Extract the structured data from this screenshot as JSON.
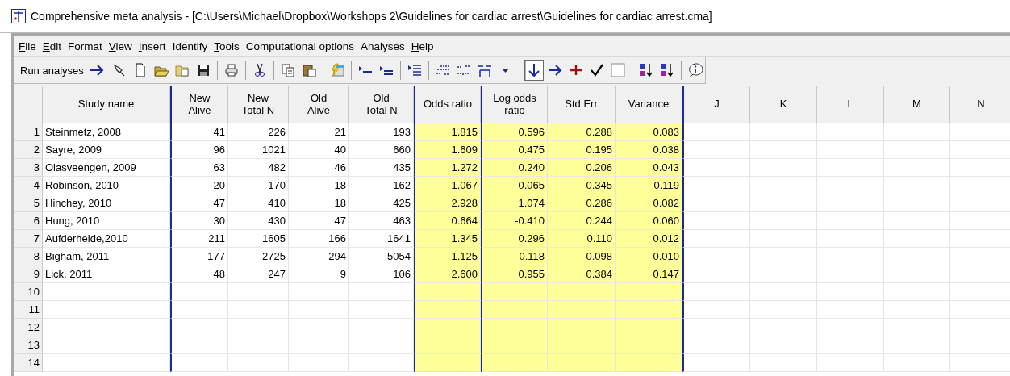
{
  "window": {
    "title": "Comprehensive meta analysis - [C:\\Users\\Michael\\Dropbox\\Workshops 2\\Guidelines for cardiac arrest\\Guidelines for cardiac arrest.cma]"
  },
  "menu": [
    {
      "label": "File",
      "mnemonic": true
    },
    {
      "label": "Edit",
      "mnemonic": true
    },
    {
      "label": "Format",
      "mnemonic": false
    },
    {
      "label": "View",
      "mnemonic": true
    },
    {
      "label": "Insert",
      "mnemonic": true
    },
    {
      "label": "Identify",
      "mnemonic": false
    },
    {
      "label": "Tools",
      "mnemonic": true
    },
    {
      "label": "Computational options",
      "mnemonic": false
    },
    {
      "label": "Analyses",
      "mnemonic": false
    },
    {
      "label": "Help",
      "mnemonic": true
    }
  ],
  "toolbar": {
    "run_label": "Run analyses",
    "items": [
      {
        "kind": "pin",
        "selected": false
      },
      {
        "kind": "page",
        "selected": false
      },
      {
        "kind": "open",
        "selected": false
      },
      {
        "kind": "folder-grid",
        "selected": false
      },
      {
        "kind": "save",
        "selected": false
      },
      {
        "kind": "separator"
      },
      {
        "kind": "print",
        "selected": false
      },
      {
        "kind": "separator"
      },
      {
        "kind": "scissors",
        "selected": false
      },
      {
        "kind": "separator"
      },
      {
        "kind": "copy",
        "selected": false
      },
      {
        "kind": "paste",
        "selected": false
      },
      {
        "kind": "separator"
      },
      {
        "kind": "lightning",
        "selected": false
      },
      {
        "kind": "separator"
      },
      {
        "kind": "indent-line",
        "selected": false
      },
      {
        "kind": "indent-equal",
        "selected": false
      },
      {
        "kind": "separator"
      },
      {
        "kind": "indent-list",
        "selected": false
      },
      {
        "kind": "separator"
      },
      {
        "kind": "decimal-add",
        "selected": false
      },
      {
        "kind": "decimal-remove",
        "selected": false
      },
      {
        "kind": "column-width",
        "selected": false
      },
      {
        "kind": "caret",
        "selected": false
      },
      {
        "kind": "separator"
      },
      {
        "kind": "arrow-down",
        "selected": true
      },
      {
        "kind": "arrow-right",
        "selected": false
      },
      {
        "kind": "plus",
        "selected": false
      },
      {
        "kind": "check",
        "selected": false
      },
      {
        "kind": "blank",
        "selected": false
      },
      {
        "kind": "separator"
      },
      {
        "kind": "sort-asc",
        "selected": false
      },
      {
        "kind": "sort-desc",
        "selected": false
      },
      {
        "kind": "separator"
      },
      {
        "kind": "info",
        "selected": false
      }
    ]
  },
  "table": {
    "columns": [
      {
        "label": "Study name",
        "kind": "text",
        "divider": false
      },
      {
        "label": "New\nAlive",
        "kind": "input",
        "divider": true
      },
      {
        "label": "New\nTotal N",
        "kind": "input",
        "divider": false
      },
      {
        "label": "Old\nAlive",
        "kind": "input",
        "divider": false
      },
      {
        "label": "Old\nTotal N",
        "kind": "input",
        "divider": false
      },
      {
        "label": "Odds ratio",
        "kind": "computed",
        "divider": true
      },
      {
        "label": "Log odds\nratio",
        "kind": "computed",
        "divider": true
      },
      {
        "label": "Std Err",
        "kind": "computed",
        "divider": false
      },
      {
        "label": "Variance",
        "kind": "computed",
        "divider": false
      },
      {
        "label": "J",
        "kind": "empty",
        "divider": true
      },
      {
        "label": "K",
        "kind": "empty",
        "divider": false
      },
      {
        "label": "L",
        "kind": "empty",
        "divider": false
      },
      {
        "label": "M",
        "kind": "empty",
        "divider": false
      },
      {
        "label": "N",
        "kind": "empty",
        "divider": false
      }
    ],
    "rows": [
      {
        "number": "1",
        "cells": [
          "Steinmetz, 2008",
          "41",
          "226",
          "21",
          "193",
          "1.815",
          "0.596",
          "0.288",
          "0.083"
        ]
      },
      {
        "number": "2",
        "cells": [
          "Sayre, 2009",
          "96",
          "1021",
          "40",
          "660",
          "1.609",
          "0.475",
          "0.195",
          "0.038"
        ]
      },
      {
        "number": "3",
        "cells": [
          "Olasveengen, 2009",
          "63",
          "482",
          "46",
          "435",
          "1.272",
          "0.240",
          "0.206",
          "0.043"
        ]
      },
      {
        "number": "4",
        "cells": [
          "Robinson, 2010",
          "20",
          "170",
          "18",
          "162",
          "1.067",
          "0.065",
          "0.345",
          "0.119"
        ]
      },
      {
        "number": "5",
        "cells": [
          "Hinchey, 2010",
          "47",
          "410",
          "18",
          "425",
          "2.928",
          "1.074",
          "0.286",
          "0.082"
        ]
      },
      {
        "number": "6",
        "cells": [
          "Hung, 2010",
          "30",
          "430",
          "47",
          "463",
          "0.664",
          "-0.410",
          "0.244",
          "0.060"
        ]
      },
      {
        "number": "7",
        "cells": [
          "Aufderheide,2010",
          "211",
          "1605",
          "166",
          "1641",
          "1.345",
          "0.296",
          "0.110",
          "0.012"
        ]
      },
      {
        "number": "8",
        "cells": [
          "Bigham, 2011",
          "177",
          "2725",
          "294",
          "5054",
          "1.125",
          "0.118",
          "0.098",
          "0.010"
        ]
      },
      {
        "number": "9",
        "cells": [
          "Lick, 2011",
          "48",
          "247",
          "9",
          "106",
          "2.600",
          "0.955",
          "0.384",
          "0.147"
        ]
      },
      {
        "number": "10",
        "cells": []
      },
      {
        "number": "11",
        "cells": []
      },
      {
        "number": "12",
        "cells": []
      },
      {
        "number": "13",
        "cells": []
      },
      {
        "number": "14",
        "cells": []
      }
    ]
  }
}
